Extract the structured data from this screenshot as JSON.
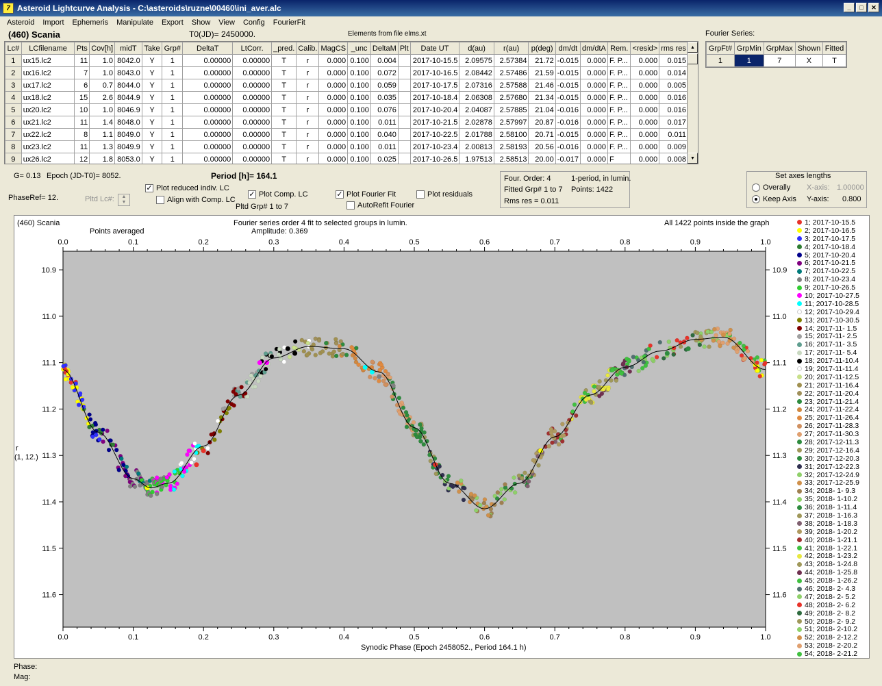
{
  "app": {
    "title": "Asteroid Lightcurve Analysis - C:\\asteroids\\ruzne\\00460\\ini_aver.alc",
    "icon_letter": "7",
    "min": "_",
    "max": "□",
    "close": "✕"
  },
  "menu": [
    "Asteroid",
    "Import",
    "Ephemeris",
    "Manipulate",
    "Export",
    "Show",
    "View",
    "Config",
    "FourierFit"
  ],
  "header": {
    "object": "(460) Scania",
    "t0": "T0(JD)= 2450000.",
    "elements": "Elements from file elms.xt",
    "fourier_series_label": "Fourier Series:"
  },
  "table": {
    "columns": [
      "Lc#",
      "LCfilename",
      "Pts",
      "Cov[h]",
      "midT",
      "Take",
      "Grp#",
      "DeltaT",
      "LtCorr.",
      "_pred.",
      "Calib.",
      "MagCS",
      "_unc",
      "DeltaM",
      "Plt",
      "Date UT",
      "d(au)",
      "r(au)",
      "p(deg)",
      "dm/dt",
      "dm/dtA",
      "Rem.",
      "<resid>",
      "rms res"
    ],
    "rows": [
      [
        "1",
        "ux15.lc2",
        "11",
        "1.0",
        "8042.0",
        "Y",
        "1",
        "0.00000",
        "0.00000",
        "T",
        "r",
        "0.000",
        "0.100",
        "0.004",
        "",
        "2017-10-15.5",
        "2.09575",
        "2.57384",
        "21.72",
        "-0.015",
        "0.000",
        "F. P...",
        "0.000",
        "0.015"
      ],
      [
        "2",
        "ux16.lc2",
        "7",
        "1.0",
        "8043.0",
        "Y",
        "1",
        "0.00000",
        "0.00000",
        "T",
        "r",
        "0.000",
        "0.100",
        "0.072",
        "",
        "2017-10-16.5",
        "2.08442",
        "2.57486",
        "21.59",
        "-0.015",
        "0.000",
        "F. P...",
        "0.000",
        "0.014"
      ],
      [
        "3",
        "ux17.lc2",
        "6",
        "0.7",
        "8044.0",
        "Y",
        "1",
        "0.00000",
        "0.00000",
        "T",
        "r",
        "0.000",
        "0.100",
        "0.059",
        "",
        "2017-10-17.5",
        "2.07316",
        "2.57588",
        "21.46",
        "-0.015",
        "0.000",
        "F. P...",
        "0.000",
        "0.005"
      ],
      [
        "4",
        "ux18.lc2",
        "15",
        "2.6",
        "8044.9",
        "Y",
        "1",
        "0.00000",
        "0.00000",
        "T",
        "r",
        "0.000",
        "0.100",
        "0.035",
        "",
        "2017-10-18.4",
        "2.06308",
        "2.57680",
        "21.34",
        "-0.015",
        "0.000",
        "F. P...",
        "0.000",
        "0.016"
      ],
      [
        "5",
        "ux20.lc2",
        "10",
        "1.0",
        "8046.9",
        "Y",
        "1",
        "0.00000",
        "0.00000",
        "T",
        "r",
        "0.000",
        "0.100",
        "0.076",
        "",
        "2017-10-20.4",
        "2.04087",
        "2.57885",
        "21.04",
        "-0.016",
        "0.000",
        "F. P...",
        "0.000",
        "0.016"
      ],
      [
        "6",
        "ux21.lc2",
        "11",
        "1.4",
        "8048.0",
        "Y",
        "1",
        "0.00000",
        "0.00000",
        "T",
        "r",
        "0.000",
        "0.100",
        "0.011",
        "",
        "2017-10-21.5",
        "2.02878",
        "2.57997",
        "20.87",
        "-0.016",
        "0.000",
        "F. P...",
        "0.000",
        "0.017"
      ],
      [
        "7",
        "ux22.lc2",
        "8",
        "1.1",
        "8049.0",
        "Y",
        "1",
        "0.00000",
        "0.00000",
        "T",
        "r",
        "0.000",
        "0.100",
        "0.040",
        "",
        "2017-10-22.5",
        "2.01788",
        "2.58100",
        "20.71",
        "-0.015",
        "0.000",
        "F. P...",
        "0.000",
        "0.011"
      ],
      [
        "8",
        "ux23.lc2",
        "11",
        "1.3",
        "8049.9",
        "Y",
        "1",
        "0.00000",
        "0.00000",
        "T",
        "r",
        "0.000",
        "0.100",
        "0.011",
        "",
        "2017-10-23.4",
        "2.00813",
        "2.58193",
        "20.56",
        "-0.016",
        "0.000",
        "F. P...",
        "0.000",
        "0.009"
      ],
      [
        "9",
        "ux26.lc2",
        "12",
        "1.8",
        "8053.0",
        "Y",
        "1",
        "0.00000",
        "0.00000",
        "T",
        "r",
        "0.000",
        "0.100",
        "0.025",
        "",
        "2017-10-26.5",
        "1.97513",
        "2.58513",
        "20.00",
        "-0.017",
        "0.000",
        "F",
        "0.000",
        "0.008"
      ]
    ]
  },
  "fourier_table": {
    "columns": [
      "GrpFt#",
      "GrpMin",
      "GrpMax",
      "Shown",
      "Fitted"
    ],
    "row": [
      "1",
      "1",
      "7",
      "X",
      "T"
    ]
  },
  "controls": {
    "g": "G= 0.13",
    "epoch": "Epoch (JD-T0)= 8052.",
    "period": "Period [h]= 164.1",
    "phaseref": "PhaseRef= 12.",
    "pltd_lc": "Pltd Lc#:",
    "plot_reduced": "Plot reduced indiv. LC",
    "align_comp": "Align with Comp. LC",
    "plot_comp": "Plot Comp. LC",
    "pltd_grp": "Pltd Grp#  1   to   7",
    "plot_fourier": "Plot Fourier Fit",
    "autorefit": "AutoRefit Fourier",
    "plot_resid": "Plot residuals",
    "four_order": "Four. Order:  4",
    "fitted_grp": "Fitted Grp# 1 to 7",
    "rms": "Rms res     = 0.011",
    "one_period": "1-period, in lumin.",
    "points": "Points: 1422",
    "axes_title": "Set axes lengths",
    "overally": "Overally",
    "keep_axis": "Keep Axis",
    "xaxis_label": "X-axis:",
    "xaxis_val": "1.00000",
    "yaxis_label": "Y-axis:",
    "yaxis_val": "0.800"
  },
  "plot": {
    "object": "(460) Scania",
    "points_avg": "Points averaged",
    "fourier_title": "Fourier series order 4 fit to selected groups in lumin.",
    "amplitude": "Amplitude: 0.369",
    "inside": "All 1422 points inside the graph",
    "ylabel1": "r",
    "ylabel2": "(1, 12.)",
    "xlabel": "Synodic Phase (Epoch 2458052., Period 164.1 h)",
    "xticks": [
      "0.0",
      "0.1",
      "0.2",
      "0.3",
      "0.4",
      "0.5",
      "0.6",
      "0.7",
      "0.8",
      "0.9",
      "1.0"
    ],
    "yticks": [
      "10.9",
      "11.0",
      "11.1",
      "11.2",
      "11.3",
      "11.4",
      "11.5",
      "11.6"
    ]
  },
  "chart_data": {
    "type": "scatter",
    "xlabel": "Synodic Phase (Epoch 2458052., Period 164.1 h)",
    "ylabel": "r (1, 12.)",
    "xlim": [
      0,
      1
    ],
    "ylim": [
      11.67,
      10.86
    ],
    "fourier_fit": {
      "x": [
        0,
        0.05,
        0.1,
        0.125,
        0.15,
        0.2,
        0.25,
        0.3,
        0.35,
        0.4,
        0.45,
        0.5,
        0.55,
        0.6,
        0.65,
        0.7,
        0.75,
        0.8,
        0.85,
        0.9,
        0.94,
        1.0
      ],
      "y": [
        11.115,
        11.25,
        11.35,
        11.37,
        11.36,
        11.28,
        11.17,
        11.09,
        11.065,
        11.07,
        11.12,
        11.24,
        11.36,
        11.415,
        11.36,
        11.26,
        11.17,
        11.11,
        11.075,
        11.05,
        11.045,
        11.115
      ]
    },
    "series": [
      {
        "name": "1; 2017-10-15.5",
        "color": "#e8332a",
        "x": [
          0.19,
          0.2,
          0.53
        ],
        "y": [
          11.32,
          11.29,
          11.32
        ]
      },
      {
        "name": "2; 2017-10-16.5",
        "color": "#ffff00",
        "x": [
          0.12,
          0.68
        ],
        "y": [
          11.37,
          11.29
        ]
      },
      {
        "name": "8; 2017-10-23.4",
        "color": "#808080",
        "x": [
          0.45,
          0.47
        ],
        "y": [
          11.13,
          11.15
        ]
      },
      {
        "name": "11; 2017-10-28.5",
        "color": "#00ffff",
        "x": [
          0.43,
          0.44
        ],
        "y": [
          11.11,
          11.12
        ]
      },
      {
        "name": "18; 2017-11-10.4",
        "color": "#000000",
        "x": [
          0.32,
          0.33
        ],
        "y": [
          11.07,
          11.08
        ]
      },
      {
        "name": "10; 2017-10-27.5",
        "color": "#ff00ff",
        "x": [
          0.28,
          0.29
        ],
        "y": [
          11.1,
          11.1
        ]
      },
      {
        "name": "23; 2017-11-21.4",
        "color": "#2e8b3e",
        "x": [
          0.86,
          0.89
        ],
        "y": [
          11.08,
          11.07
        ]
      },
      {
        "name": "33; 2017-12-25.9",
        "color": "#d0904a",
        "x": [
          0.94,
          0.95
        ],
        "y": [
          11.04,
          11.05
        ]
      }
    ]
  },
  "legend": [
    {
      "t": "1; 2017-10-15.5",
      "c": "#e8332a"
    },
    {
      "t": "2; 2017-10-16.5",
      "c": "#ffff00"
    },
    {
      "t": "3; 2017-10-17.5",
      "c": "#3030ff"
    },
    {
      "t": "4; 2017-10-18.4",
      "c": "#2e7d32"
    },
    {
      "t": "5; 2017-10-20.4",
      "c": "#00008b"
    },
    {
      "t": "6; 2017-10-21.5",
      "c": "#800080"
    },
    {
      "t": "7; 2017-10-22.5",
      "c": "#007b7b"
    },
    {
      "t": "8; 2017-10-23.4",
      "c": "#808080"
    },
    {
      "t": "9; 2017-10-26.5",
      "c": "#32cd32"
    },
    {
      "t": "10; 2017-10-27.5",
      "c": "#ff00ff"
    },
    {
      "t": "11; 2017-10-28.5",
      "c": "#00ffff"
    },
    {
      "t": "12; 2017-10-29.4",
      "c": "#ffffff"
    },
    {
      "t": "13; 2017-10-30.5",
      "c": "#808000"
    },
    {
      "t": "14; 2017-11- 1.5",
      "c": "#800000"
    },
    {
      "t": "15; 2017-11- 2.5",
      "c": "#a0a0a0"
    },
    {
      "t": "16; 2017-11- 3.5",
      "c": "#5f9e8f"
    },
    {
      "t": "17; 2017-11- 5.4",
      "c": "#c8d8c0"
    },
    {
      "t": "18; 2017-11-10.4",
      "c": "#000000"
    },
    {
      "t": "19; 2017-11-11.4",
      "c": "#ffffff"
    },
    {
      "t": "20; 2017-11-12.5",
      "c": "#c8e08a"
    },
    {
      "t": "21; 2017-11-16.4",
      "c": "#a09050"
    },
    {
      "t": "22; 2017-11-20.4",
      "c": "#a0905a"
    },
    {
      "t": "23; 2017-11-21.4",
      "c": "#2e8b3e"
    },
    {
      "t": "24; 2017-11-22.4",
      "c": "#d08840"
    },
    {
      "t": "25; 2017-11-26.4",
      "c": "#e08a40"
    },
    {
      "t": "26; 2017-11-28.3",
      "c": "#d09060"
    },
    {
      "t": "27; 2017-11-30.3",
      "c": "#e0a070"
    },
    {
      "t": "28; 2017-12-11.3",
      "c": "#2e8b3e"
    },
    {
      "t": "29; 2017-12-16.4",
      "c": "#a0985a"
    },
    {
      "t": "30; 2017-12-20.3",
      "c": "#2e8b3e"
    },
    {
      "t": "31; 2017-12-22.3",
      "c": "#303050"
    },
    {
      "t": "32; 2017-12-24.9",
      "c": "#8fd06a"
    },
    {
      "t": "33; 2017-12-25.9",
      "c": "#d0904a"
    },
    {
      "t": "34; 2018- 1- 9.3",
      "c": "#a08050"
    },
    {
      "t": "35; 2018- 1-10.2",
      "c": "#8fd06a"
    },
    {
      "t": "36; 2018- 1-11.4",
      "c": "#2e8b3e"
    },
    {
      "t": "37; 2018- 1-16.3",
      "c": "#a0985a"
    },
    {
      "t": "38; 2018- 1-18.3",
      "c": "#806070"
    },
    {
      "t": "39; 2018- 1-20.2",
      "c": "#b09a60"
    },
    {
      "t": "40; 2018- 1-21.1",
      "c": "#a03030"
    },
    {
      "t": "41; 2018- 1-22.1",
      "c": "#40c040"
    },
    {
      "t": "42; 2018- 1-23.2",
      "c": "#e8e840"
    },
    {
      "t": "43; 2018- 1-24.8",
      "c": "#a0985a"
    },
    {
      "t": "44; 2018- 1-25.8",
      "c": "#703050"
    },
    {
      "t": "45; 2018- 1-26.2",
      "c": "#40c040"
    },
    {
      "t": "46; 2018- 2- 4.3",
      "c": "#507070"
    },
    {
      "t": "47; 2018- 2- 5.2",
      "c": "#8fd06a"
    },
    {
      "t": "48; 2018- 2- 6.2",
      "c": "#e8332a"
    },
    {
      "t": "49; 2018- 2- 8.2",
      "c": "#2e6b3e"
    },
    {
      "t": "50; 2018- 2- 9.2",
      "c": "#a0985a"
    },
    {
      "t": "51; 2018- 2-10.2",
      "c": "#8fd06a"
    },
    {
      "t": "52; 2018- 2-12.2",
      "c": "#d0904a"
    },
    {
      "t": "53; 2018- 2-20.2",
      "c": "#e0a070"
    },
    {
      "t": "54; 2018- 2-21.2",
      "c": "#40c040"
    }
  ],
  "status": {
    "phase": "Phase:",
    "mag": "Mag:"
  }
}
